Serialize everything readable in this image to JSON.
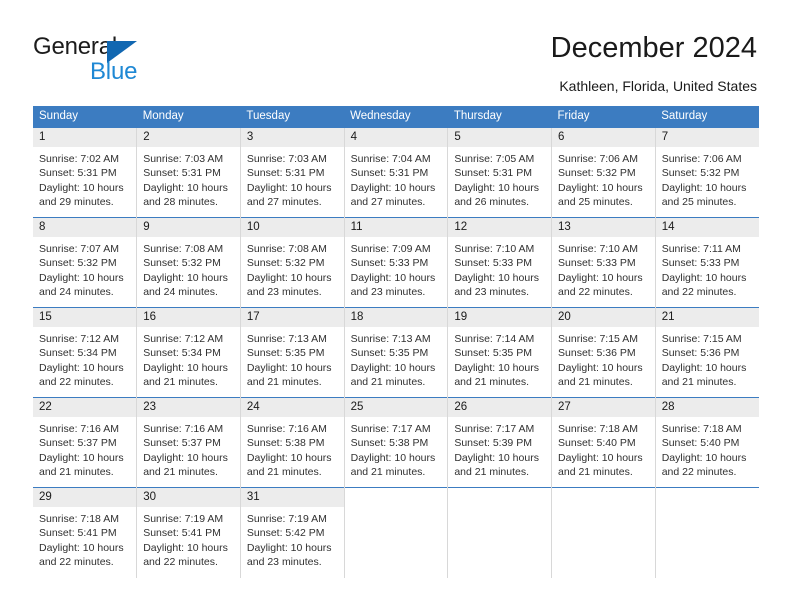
{
  "brand": {
    "name_top": "General",
    "name_bottom": "Blue"
  },
  "header": {
    "title": "December 2024",
    "location": "Kathleen, Florida, United States"
  },
  "calendar": {
    "weekday_headers": [
      "Sunday",
      "Monday",
      "Tuesday",
      "Wednesday",
      "Thursday",
      "Friday",
      "Saturday"
    ],
    "accent_color": "#3c7cc1",
    "daynum_band_color": "#ececec",
    "weeks": [
      [
        {
          "day": "1",
          "sunrise": "Sunrise: 7:02 AM",
          "sunset": "Sunset: 5:31 PM",
          "daylight1": "Daylight: 10 hours",
          "daylight2": "and 29 minutes."
        },
        {
          "day": "2",
          "sunrise": "Sunrise: 7:03 AM",
          "sunset": "Sunset: 5:31 PM",
          "daylight1": "Daylight: 10 hours",
          "daylight2": "and 28 minutes."
        },
        {
          "day": "3",
          "sunrise": "Sunrise: 7:03 AM",
          "sunset": "Sunset: 5:31 PM",
          "daylight1": "Daylight: 10 hours",
          "daylight2": "and 27 minutes."
        },
        {
          "day": "4",
          "sunrise": "Sunrise: 7:04 AM",
          "sunset": "Sunset: 5:31 PM",
          "daylight1": "Daylight: 10 hours",
          "daylight2": "and 27 minutes."
        },
        {
          "day": "5",
          "sunrise": "Sunrise: 7:05 AM",
          "sunset": "Sunset: 5:31 PM",
          "daylight1": "Daylight: 10 hours",
          "daylight2": "and 26 minutes."
        },
        {
          "day": "6",
          "sunrise": "Sunrise: 7:06 AM",
          "sunset": "Sunset: 5:32 PM",
          "daylight1": "Daylight: 10 hours",
          "daylight2": "and 25 minutes."
        },
        {
          "day": "7",
          "sunrise": "Sunrise: 7:06 AM",
          "sunset": "Sunset: 5:32 PM",
          "daylight1": "Daylight: 10 hours",
          "daylight2": "and 25 minutes."
        }
      ],
      [
        {
          "day": "8",
          "sunrise": "Sunrise: 7:07 AM",
          "sunset": "Sunset: 5:32 PM",
          "daylight1": "Daylight: 10 hours",
          "daylight2": "and 24 minutes."
        },
        {
          "day": "9",
          "sunrise": "Sunrise: 7:08 AM",
          "sunset": "Sunset: 5:32 PM",
          "daylight1": "Daylight: 10 hours",
          "daylight2": "and 24 minutes."
        },
        {
          "day": "10",
          "sunrise": "Sunrise: 7:08 AM",
          "sunset": "Sunset: 5:32 PM",
          "daylight1": "Daylight: 10 hours",
          "daylight2": "and 23 minutes."
        },
        {
          "day": "11",
          "sunrise": "Sunrise: 7:09 AM",
          "sunset": "Sunset: 5:33 PM",
          "daylight1": "Daylight: 10 hours",
          "daylight2": "and 23 minutes."
        },
        {
          "day": "12",
          "sunrise": "Sunrise: 7:10 AM",
          "sunset": "Sunset: 5:33 PM",
          "daylight1": "Daylight: 10 hours",
          "daylight2": "and 23 minutes."
        },
        {
          "day": "13",
          "sunrise": "Sunrise: 7:10 AM",
          "sunset": "Sunset: 5:33 PM",
          "daylight1": "Daylight: 10 hours",
          "daylight2": "and 22 minutes."
        },
        {
          "day": "14",
          "sunrise": "Sunrise: 7:11 AM",
          "sunset": "Sunset: 5:33 PM",
          "daylight1": "Daylight: 10 hours",
          "daylight2": "and 22 minutes."
        }
      ],
      [
        {
          "day": "15",
          "sunrise": "Sunrise: 7:12 AM",
          "sunset": "Sunset: 5:34 PM",
          "daylight1": "Daylight: 10 hours",
          "daylight2": "and 22 minutes."
        },
        {
          "day": "16",
          "sunrise": "Sunrise: 7:12 AM",
          "sunset": "Sunset: 5:34 PM",
          "daylight1": "Daylight: 10 hours",
          "daylight2": "and 21 minutes."
        },
        {
          "day": "17",
          "sunrise": "Sunrise: 7:13 AM",
          "sunset": "Sunset: 5:35 PM",
          "daylight1": "Daylight: 10 hours",
          "daylight2": "and 21 minutes."
        },
        {
          "day": "18",
          "sunrise": "Sunrise: 7:13 AM",
          "sunset": "Sunset: 5:35 PM",
          "daylight1": "Daylight: 10 hours",
          "daylight2": "and 21 minutes."
        },
        {
          "day": "19",
          "sunrise": "Sunrise: 7:14 AM",
          "sunset": "Sunset: 5:35 PM",
          "daylight1": "Daylight: 10 hours",
          "daylight2": "and 21 minutes."
        },
        {
          "day": "20",
          "sunrise": "Sunrise: 7:15 AM",
          "sunset": "Sunset: 5:36 PM",
          "daylight1": "Daylight: 10 hours",
          "daylight2": "and 21 minutes."
        },
        {
          "day": "21",
          "sunrise": "Sunrise: 7:15 AM",
          "sunset": "Sunset: 5:36 PM",
          "daylight1": "Daylight: 10 hours",
          "daylight2": "and 21 minutes."
        }
      ],
      [
        {
          "day": "22",
          "sunrise": "Sunrise: 7:16 AM",
          "sunset": "Sunset: 5:37 PM",
          "daylight1": "Daylight: 10 hours",
          "daylight2": "and 21 minutes."
        },
        {
          "day": "23",
          "sunrise": "Sunrise: 7:16 AM",
          "sunset": "Sunset: 5:37 PM",
          "daylight1": "Daylight: 10 hours",
          "daylight2": "and 21 minutes."
        },
        {
          "day": "24",
          "sunrise": "Sunrise: 7:16 AM",
          "sunset": "Sunset: 5:38 PM",
          "daylight1": "Daylight: 10 hours",
          "daylight2": "and 21 minutes."
        },
        {
          "day": "25",
          "sunrise": "Sunrise: 7:17 AM",
          "sunset": "Sunset: 5:38 PM",
          "daylight1": "Daylight: 10 hours",
          "daylight2": "and 21 minutes."
        },
        {
          "day": "26",
          "sunrise": "Sunrise: 7:17 AM",
          "sunset": "Sunset: 5:39 PM",
          "daylight1": "Daylight: 10 hours",
          "daylight2": "and 21 minutes."
        },
        {
          "day": "27",
          "sunrise": "Sunrise: 7:18 AM",
          "sunset": "Sunset: 5:40 PM",
          "daylight1": "Daylight: 10 hours",
          "daylight2": "and 21 minutes."
        },
        {
          "day": "28",
          "sunrise": "Sunrise: 7:18 AM",
          "sunset": "Sunset: 5:40 PM",
          "daylight1": "Daylight: 10 hours",
          "daylight2": "and 22 minutes."
        }
      ],
      [
        {
          "day": "29",
          "sunrise": "Sunrise: 7:18 AM",
          "sunset": "Sunset: 5:41 PM",
          "daylight1": "Daylight: 10 hours",
          "daylight2": "and 22 minutes."
        },
        {
          "day": "30",
          "sunrise": "Sunrise: 7:19 AM",
          "sunset": "Sunset: 5:41 PM",
          "daylight1": "Daylight: 10 hours",
          "daylight2": "and 22 minutes."
        },
        {
          "day": "31",
          "sunrise": "Sunrise: 7:19 AM",
          "sunset": "Sunset: 5:42 PM",
          "daylight1": "Daylight: 10 hours",
          "daylight2": "and 23 minutes."
        },
        {
          "day": "",
          "sunrise": "",
          "sunset": "",
          "daylight1": "",
          "daylight2": ""
        },
        {
          "day": "",
          "sunrise": "",
          "sunset": "",
          "daylight1": "",
          "daylight2": ""
        },
        {
          "day": "",
          "sunrise": "",
          "sunset": "",
          "daylight1": "",
          "daylight2": ""
        },
        {
          "day": "",
          "sunrise": "",
          "sunset": "",
          "daylight1": "",
          "daylight2": ""
        }
      ]
    ]
  }
}
